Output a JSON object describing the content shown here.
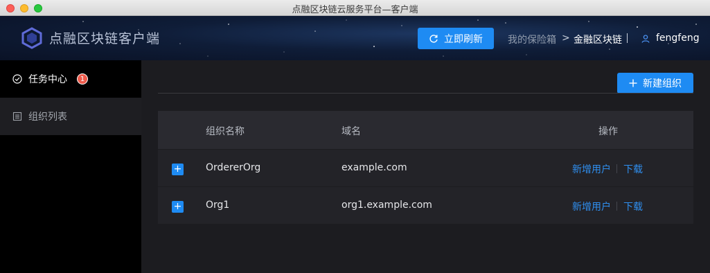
{
  "window": {
    "title": "点融区块链云服务平台—客户端",
    "controls": [
      "close",
      "minimize",
      "maximize"
    ]
  },
  "header": {
    "logo_icon": "hexagon-logo-icon",
    "app_name": "点融区块链客户端",
    "refresh_label": "立即刷新",
    "refresh_icon": "refresh-icon",
    "breadcrumb": {
      "parent": "我的保险箱",
      "separator": ">",
      "current": "金融区块链"
    },
    "user_icon": "user-icon",
    "username": "fengfeng"
  },
  "sidebar": {
    "items": [
      {
        "label": "任务中心",
        "icon": "check-circle-icon",
        "badge": "1",
        "active": true
      },
      {
        "label": "组织列表",
        "icon": "list-icon",
        "active": false
      }
    ]
  },
  "main": {
    "new_org_label": "新建组织",
    "new_org_icon": "plus-icon",
    "table": {
      "headers": {
        "name": "组织名称",
        "domain": "域名",
        "operations": "操作"
      },
      "rows": [
        {
          "name": "OrdererOrg",
          "domain": "example.com",
          "add_user": "新增用户",
          "download": "下载"
        },
        {
          "name": "Org1",
          "domain": "org1.example.com",
          "add_user": "新增用户",
          "download": "下载"
        }
      ],
      "expand_symbol": "+"
    }
  },
  "colors": {
    "accent": "#1e8bf3",
    "link": "#2f8ff0",
    "badge": "#ef5b4c",
    "sidebar_bg": "#000000",
    "main_bg": "#1c1c20"
  }
}
